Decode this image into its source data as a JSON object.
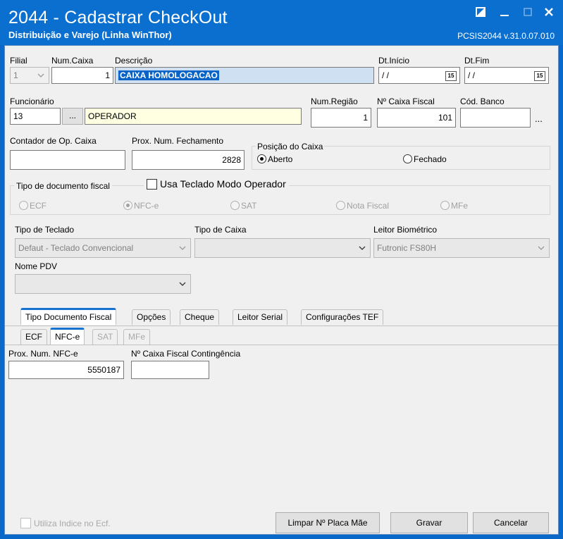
{
  "window": {
    "title": "2044 - Cadastrar CheckOut",
    "subtitle": "Distribuição e Varejo (Linha WinThor)",
    "version": "PCSIS2044  v.31.0.07.010"
  },
  "fields": {
    "filial_label": "Filial",
    "filial_value": "1",
    "num_caixa_label": "Num.Caixa",
    "num_caixa_value": "1",
    "descricao_label": "Descrição",
    "descricao_value": "CAIXA HOMOLOGACAO",
    "dt_inicio_label": "Dt.Início",
    "dt_inicio_value": "/ /",
    "dt_fim_label": "Dt.Fim",
    "dt_fim_value": "/ /",
    "calendar_glyph": "15",
    "funcionario_label": "Funcionário",
    "funcionario_code": "13",
    "funcionario_ellipsis": "...",
    "funcionario_name": "OPERADOR",
    "num_regiao_label": "Num.Região",
    "num_regiao_value": "1",
    "caixa_fiscal_label": "Nº Caixa Fiscal",
    "caixa_fiscal_value": "101",
    "cod_banco_label": "Cód. Banco",
    "cod_banco_value": "",
    "cod_banco_ellipsis": "...",
    "contador_label": "Contador de Op. Caixa",
    "contador_value": "",
    "prox_fechamento_label": "Prox. Num. Fechamento",
    "prox_fechamento_value": "2828"
  },
  "posicao": {
    "legend": "Posição do Caixa",
    "aberto": "Aberto",
    "fechado": "Fechado"
  },
  "tipo_doc": {
    "legend": "Tipo de documento fiscal",
    "usa_teclado": "Usa Teclado Modo Operador",
    "options": [
      "ECF",
      "NFC-e",
      "SAT",
      "Nota Fiscal",
      "MFe"
    ]
  },
  "combos": {
    "tipo_teclado_label": "Tipo de Teclado",
    "tipo_teclado_value": "Defaut - Teclado Convencional",
    "tipo_caixa_label": "Tipo de Caixa",
    "tipo_caixa_value": "",
    "leitor_label": "Leitor Biométrico",
    "leitor_value": "Futronic FS80H",
    "nome_pdv_label": "Nome PDV",
    "nome_pdv_value": ""
  },
  "tabs": [
    "Tipo Documento Fiscal",
    "Opções",
    "Cheque",
    "Leitor Serial",
    "Configurações TEF"
  ],
  "subtabs": [
    "ECF",
    "NFC-e",
    "SAT",
    "MFe"
  ],
  "nfce": {
    "prox_num_label": "Prox. Num. NFC-e",
    "prox_num_value": "5550187",
    "contingencia_label": "Nº Caixa Fiscal Contingência",
    "contingencia_value": ""
  },
  "footer": {
    "utiliza_indice": "Utiliza Indice no Ecf.",
    "limpar": "Limpar Nº Placa Mãe",
    "gravar": "Gravar",
    "cancelar": "Cancelar"
  },
  "colors": {
    "titlebar": "#0b6fd0",
    "selection": "#0a64c8",
    "tab_accent": "#1672d1"
  }
}
